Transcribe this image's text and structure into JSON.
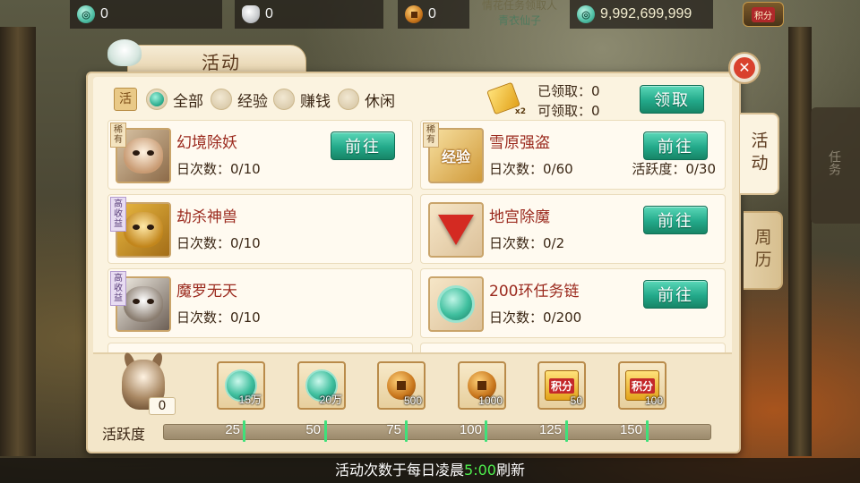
{
  "topbar": {
    "jade": {
      "icon": "jade-currency-icon",
      "value": "0"
    },
    "silver": {
      "icon": "silver-ingot-icon",
      "value": "0"
    },
    "copper": {
      "icon": "copper-coin-icon",
      "value": "0"
    },
    "notice_line1": "情花任务领取人",
    "notice_line2": "青衣仙子",
    "gold_jade": {
      "icon": "jade-currency-icon",
      "value": "9,992,699,999"
    },
    "points_button": "积分"
  },
  "panel": {
    "title": "活动",
    "close_icon": "close-icon"
  },
  "side_tabs": [
    {
      "label": "活动",
      "active": true
    },
    {
      "label": "周历",
      "active": false
    }
  ],
  "right_edge": {
    "label": "任务"
  },
  "filters": {
    "book_icon": "活",
    "options": [
      {
        "label": "全部",
        "selected": true
      },
      {
        "label": "经验",
        "selected": false
      },
      {
        "label": "赚钱",
        "selected": false
      },
      {
        "label": "休闲",
        "selected": false
      }
    ]
  },
  "claim": {
    "icon_label": "经验",
    "multiplier": "x2",
    "claimed": "已领取：0",
    "claimable": "可领取：0",
    "button": "领取"
  },
  "activities": [
    {
      "name": "幻境除妖",
      "daily": "日次数：0/10",
      "active_pts": "",
      "badge": "稀有",
      "badge_type": "normal",
      "button": "前往",
      "icon": "demon-beast-icon"
    },
    {
      "name": "雪原强盗",
      "daily": "日次数：0/60",
      "active_pts": "活跃度：0/30",
      "badge": "稀有",
      "badge_type": "normal",
      "button": "前往",
      "icon": "exp-gourd-icon",
      "icon_text": "经验"
    },
    {
      "name": "劫杀神兽",
      "daily": "日次数：0/10",
      "active_pts": "",
      "badge": "高收益",
      "badge_type": "purple",
      "button": "",
      "icon": "golden-beast-icon"
    },
    {
      "name": "地宫除魔",
      "daily": "日次数：0/2",
      "active_pts": "",
      "badge": "",
      "badge_type": "",
      "button": "前往",
      "icon": "red-gem-icon"
    },
    {
      "name": "魔罗无天",
      "daily": "日次数：0/10",
      "active_pts": "",
      "badge": "高收益",
      "badge_type": "purple",
      "button": "",
      "icon": "owl-demon-icon"
    },
    {
      "name": "200环任务链",
      "daily": "日次数：0/200",
      "active_pts": "",
      "badge": "",
      "badge_type": "",
      "button": "前往",
      "icon": "jade-ring-icon"
    }
  ],
  "rewards": {
    "mascot_icon": "donkey-mascot-icon",
    "mascot_count": "0",
    "items": [
      {
        "icon": "jade-currency-icon",
        "amount": "15万"
      },
      {
        "icon": "jade-currency-icon",
        "amount": "20万"
      },
      {
        "icon": "copper-coin-icon",
        "amount": "500"
      },
      {
        "icon": "copper-coin-icon",
        "amount": "1000"
      },
      {
        "icon": "points-giftbox-icon",
        "amount": "50",
        "box_label": "积分"
      },
      {
        "icon": "points-giftbox-icon",
        "amount": "100",
        "box_label": "积分"
      }
    ]
  },
  "activity_track": {
    "label": "活跃度",
    "current": 0,
    "max": 150,
    "milestones": [
      "25",
      "50",
      "75",
      "100",
      "125",
      "150"
    ]
  },
  "footer": {
    "prefix": "活动次数于每日凌晨",
    "time": "5:00",
    "suffix": "刷新"
  },
  "colors": {
    "accent_green": "#23a98a",
    "title_red": "#9b2a1e",
    "milestone_green": "#3fe07a",
    "close_red": "#d9412d"
  }
}
